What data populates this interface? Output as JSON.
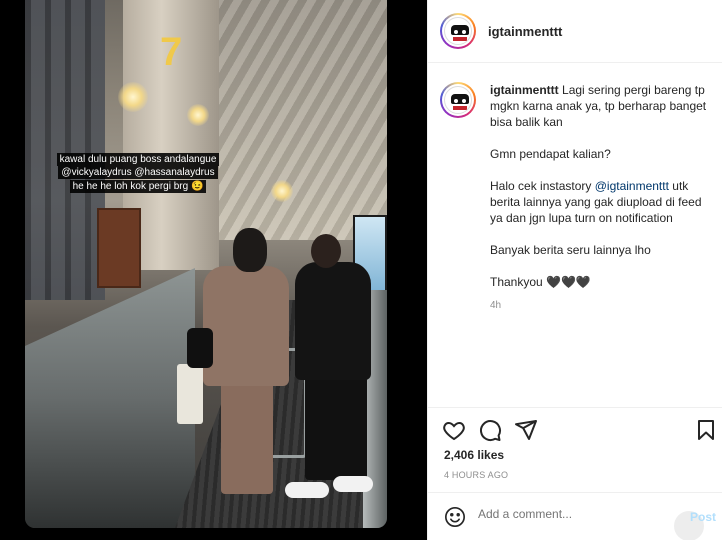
{
  "media": {
    "pillar_number": "7",
    "story_caption": {
      "line1": "kawal dulu puang boss andalangue",
      "line2": "@vickyalaydrus @hassanalaydrus",
      "line3": "he he he loh kok pergi brg 😉"
    }
  },
  "header": {
    "username": "igtainmenttt"
  },
  "post": {
    "author": "igtainmenttt",
    "caption_para1": "Lagi sering pergi bareng tp mgkn karna anak ya, tp berharap banget bisa balik kan",
    "caption_para2": "Gmn pendapat kalian?",
    "caption_para3_pre": "Halo cek instastory ",
    "caption_para3_mention": "@igtainmenttt",
    "caption_para3_post": " utk berita lainnya yang gak diupload di feed ya dan jgn lupa turn on notification",
    "caption_para4": "Banyak berita seru lainnya lho",
    "caption_para5": "Thankyou 🖤🖤🖤",
    "time_short": "4h"
  },
  "actions": {
    "icons": [
      "heart-icon",
      "comment-icon",
      "share-icon",
      "bookmark-icon"
    ],
    "likes": "2,406 likes",
    "time_ago": "4 HOURS AGO"
  },
  "comment_box": {
    "placeholder": "Add a comment...",
    "post_label": "Post"
  },
  "colors": {
    "link": "#00376b",
    "post_disabled": "#b2dffc",
    "muted": "#8e8e8e"
  }
}
